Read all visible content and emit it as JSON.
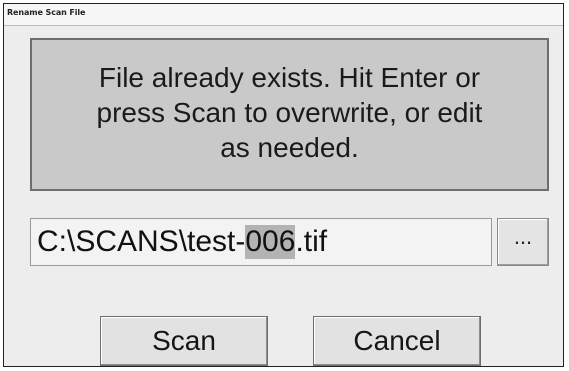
{
  "window": {
    "title": "Rename Scan File"
  },
  "message": {
    "lines": [
      "File already exists.  Hit Enter or",
      "press Scan to overwrite, or edit",
      "as needed."
    ]
  },
  "filename": {
    "prefix": "C:\\SCANS\\test-",
    "selected": "006",
    "suffix": ".tif"
  },
  "buttons": {
    "browse_label": "...",
    "scan_label": "Scan",
    "cancel_label": "Cancel"
  }
}
